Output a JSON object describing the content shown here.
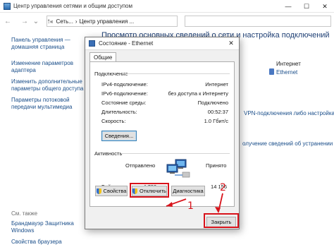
{
  "window": {
    "title": "Центр управления сетями и общим доступом",
    "min_glyph": "—",
    "max_glyph": "☐",
    "close_glyph": "✕"
  },
  "toolbar": {
    "back_glyph": "←",
    "forward_glyph": "→",
    "dropdown_glyph": "⌄",
    "up_glyph": "↑",
    "breadcrumb_sep": "«",
    "crumb_1": "Сеть...",
    "crumb_arrow": "›",
    "crumb_2": "Центр управления ..."
  },
  "left_pane": {
    "links": [
      "Панель управления —",
      "домашняя страница",
      "Изменение параметров",
      "адаптера",
      "Изменить дополнительные",
      "параметры общего доступа",
      "Параметры потоковой",
      "передачи мультимедиа"
    ],
    "see_also": "См. также",
    "bottom_links": [
      "Брандмауэр Защитника",
      "Windows",
      "Свойства браузера"
    ]
  },
  "background": {
    "heading": "Просмотр основных сведений о сети и настройка подключений",
    "access_type_value": "Интернет",
    "connection_value": "Ethernet",
    "vpn_fragment": "VPN-подключения либо настройка",
    "troubleshoot_fragment": "олучение сведений об устранении"
  },
  "dialog": {
    "title": "Состояние - Ethernet",
    "close_glyph": "✕",
    "tab": "Общие",
    "connection_group": "Подключение",
    "rows": [
      {
        "label": "IPv4-подключение:",
        "value": "Интернет"
      },
      {
        "label": "IPv6-подключение:",
        "value": "без доступа к Интернету"
      },
      {
        "label": "Состояние среды:",
        "value": "Подключено"
      },
      {
        "label": "Длительность:",
        "value": "00:52:37"
      },
      {
        "label": "Скорость:",
        "value": "1.0 Гбит/с"
      }
    ],
    "details_button": "Сведения...",
    "activity_group": "Активность",
    "sent_label": "Отправлено",
    "received_label": "Принято",
    "bytes_label": "Байт:",
    "bytes_sent": "4 788",
    "bytes_received": "14 156",
    "properties_button": "Свойства",
    "disable_button": "Отключить",
    "diagnostics_button": "Диагностика",
    "close_button": "Закрыть"
  },
  "annotations": {
    "marker_1": "1",
    "marker_2": "2"
  },
  "colors": {
    "highlight": "#d8131b",
    "link": "#1a4e8a",
    "heading": "#1e3f74"
  }
}
